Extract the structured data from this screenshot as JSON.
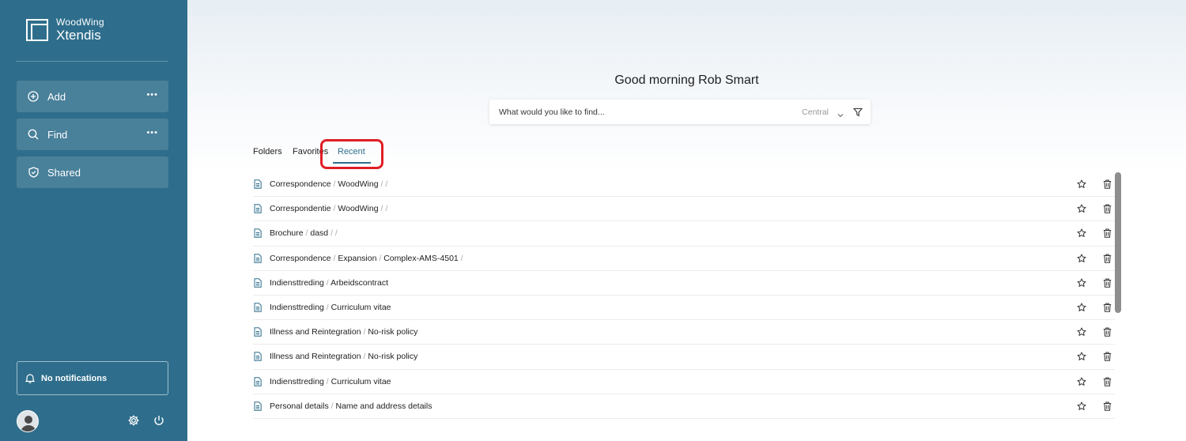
{
  "app": {
    "brand_line1": "WoodWing",
    "brand_line2": "Xtendis"
  },
  "sidebar": {
    "add_label": "Add",
    "find_label": "Find",
    "shared_label": "Shared",
    "more_glyph": "•••",
    "notifications_label": "No notifications"
  },
  "main": {
    "greeting": "Good morning Rob Smart",
    "search": {
      "placeholder": "What would you like to find...",
      "scope": "Central"
    },
    "tabs": {
      "folders": "Folders",
      "favorites": "Favorites",
      "recent": "Recent",
      "active": "Recent"
    },
    "rows": [
      {
        "parts": [
          "Correspondence",
          "WoodWing",
          "",
          ""
        ]
      },
      {
        "parts": [
          "Correspondentie",
          "WoodWing",
          "",
          ""
        ]
      },
      {
        "parts": [
          "Brochure",
          "dasd",
          "",
          ""
        ]
      },
      {
        "parts": [
          "Correspondence",
          "Expansion",
          "Complex-AMS-4501",
          ""
        ]
      },
      {
        "parts": [
          "Indiensttreding",
          "Arbeidscontract"
        ]
      },
      {
        "parts": [
          "Indiensttreding",
          "Curriculum vitae"
        ]
      },
      {
        "parts": [
          "Illness and Reintegration",
          "No-risk policy"
        ]
      },
      {
        "parts": [
          "Illness and Reintegration",
          "No-risk policy"
        ]
      },
      {
        "parts": [
          "Indiensttreding",
          "Curriculum vitae"
        ]
      },
      {
        "parts": [
          "Personal details",
          "Name and address details"
        ]
      }
    ]
  },
  "colors": {
    "sidebar_bg": "#2e6e8c",
    "accent": "#2e6e8c",
    "highlight": "#e01e26"
  },
  "icons": {
    "logo": "xtendis-logo-icon",
    "add": "plus-circle-icon",
    "find": "search-icon",
    "shared": "shield-icon",
    "notifications": "bell-icon",
    "avatar": "user-avatar-icon",
    "settings": "gear-icon",
    "logout": "power-icon",
    "scope": "chevron-down-icon",
    "filter": "filter-icon",
    "document": "document-icon",
    "favorite": "star-icon",
    "delete": "trash-icon"
  }
}
